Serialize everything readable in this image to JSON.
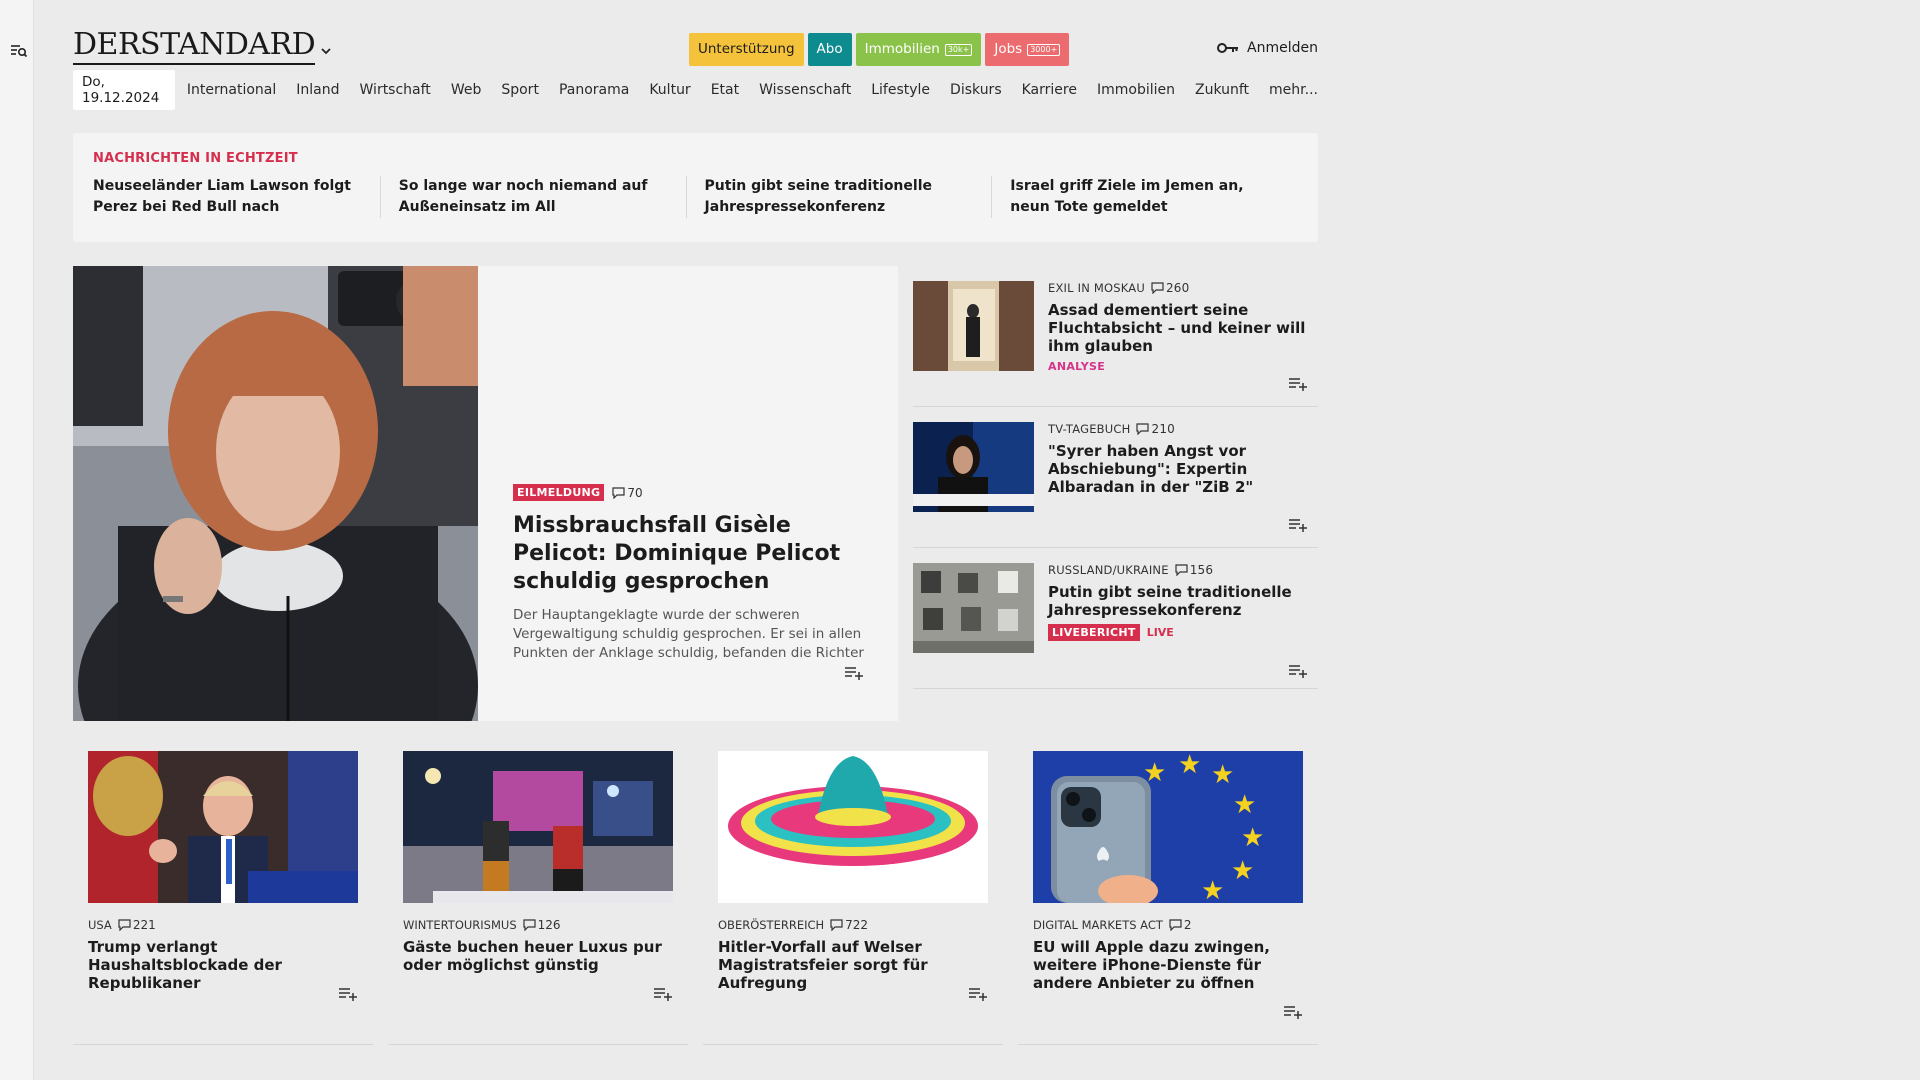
{
  "header": {
    "logo": "DERSTANDARD",
    "pills": {
      "support": "Unterstützung",
      "abo": "Abo",
      "immobilien": "Immobilien",
      "immobilien_badge": "30k+",
      "jobs": "Jobs",
      "jobs_badge": "3000+"
    },
    "login": "Anmelden"
  },
  "nav": {
    "date": "Do, 19.12.2024",
    "items": [
      "International",
      "Inland",
      "Wirtschaft",
      "Web",
      "Sport",
      "Panorama",
      "Kultur",
      "Etat",
      "Wissenschaft",
      "Lifestyle",
      "Diskurs",
      "Karriere",
      "Immobilien",
      "Zukunft",
      "mehr..."
    ]
  },
  "ticker": {
    "label": "NACHRICHTEN IN ECHTZEIT",
    "items": [
      "Neuseeländer Liam Lawson folgt Perez bei Red Bull nach",
      "So lange war noch niemand auf Außeneinsatz im All",
      "Putin gibt seine traditionelle Jahrespressekonferenz",
      "Israel griff Ziele im Jemen an, neun Tote gemeldet"
    ]
  },
  "lead": {
    "tag": "EILMELDUNG",
    "comments": "70",
    "title": "Missbrauchsfall Gisèle Pelicot: Dominique Pelicot schuldig gesprochen",
    "teaser": "Der Hauptangeklagte wurde der schweren Vergewaltigung schuldig gesprochen. Er sei in allen Punkten der Anklage schuldig, befanden die Richter"
  },
  "side": [
    {
      "kicker": "EXIL IN MOSKAU",
      "comments": "260",
      "title": "Assad dementiert seine Fluchtabsicht – und keiner will ihm glauben",
      "label": "ANALYSE"
    },
    {
      "kicker": "TV-TAGEBUCH",
      "comments": "210",
      "title": "\"Syrer haben Angst vor Abschiebung\": Expertin Albaradan in der \"ZiB 2\""
    },
    {
      "kicker": "RUSSLAND/UKRAINE",
      "comments": "156",
      "title": "Putin gibt seine traditionelle Jahrespressekonferenz",
      "tag": "LIVEBERICHT",
      "live": "LIVE"
    }
  ],
  "cards": [
    {
      "kicker": "USA",
      "comments": "221",
      "title": "Trump verlangt Haushaltsblockade der Republikaner"
    },
    {
      "kicker": "WINTERTOURISMUS",
      "comments": "126",
      "title": "Gäste buchen heuer Luxus pur oder möglichst günstig"
    },
    {
      "kicker": "OBERÖSTERREICH",
      "comments": "722",
      "title": "Hitler-Vorfall auf Welser Magistratsfeier sorgt für Aufregung"
    },
    {
      "kicker": "DIGITAL MARKETS ACT",
      "comments": "2",
      "title": "EU will Apple dazu zwingen, weitere iPhone-Dienste für andere Anbieter zu öffnen"
    }
  ],
  "colors": {
    "accent_red": "#d62f4e",
    "support": "#f5c33b",
    "abo": "#0d8b8f",
    "immobilien": "#8bc34a",
    "jobs": "#ec6b6e",
    "analyse": "#d6338a"
  }
}
